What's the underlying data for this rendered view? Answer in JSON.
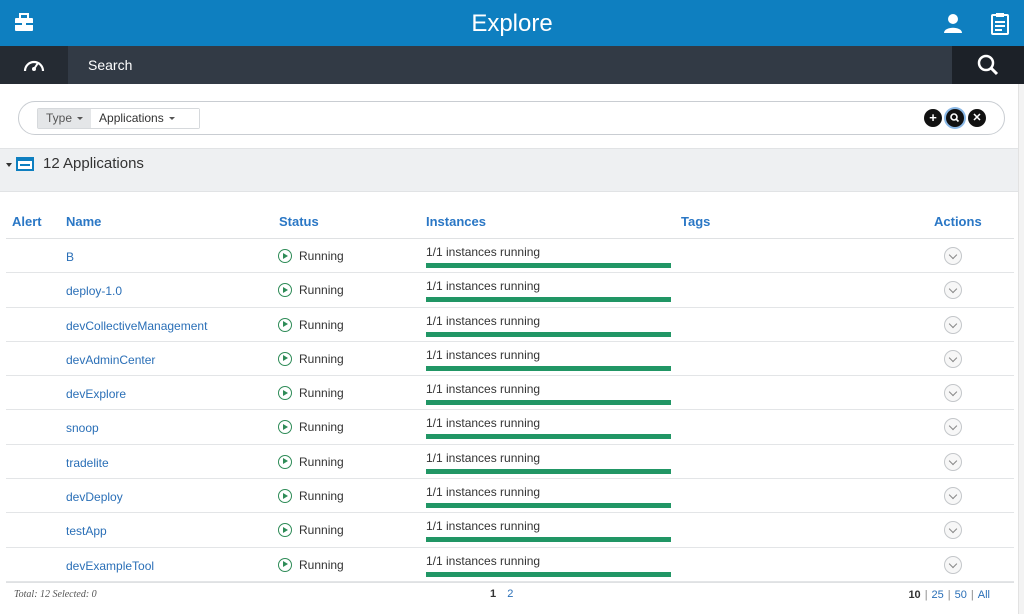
{
  "header": {
    "title": "Explore"
  },
  "nav": {
    "search_label": "Search"
  },
  "filter": {
    "type_label": "Type",
    "type_value": "Applications",
    "add_symbol": "+",
    "search_symbol": "⌕",
    "clear_symbol": "✕"
  },
  "section": {
    "count_label": "12 Applications"
  },
  "table": {
    "columns": {
      "alert": "Alert",
      "name": "Name",
      "status": "Status",
      "instances": "Instances",
      "tags": "Tags",
      "actions": "Actions"
    },
    "rows": [
      {
        "name": "B",
        "status": "Running",
        "instances": "1/1 instances running",
        "running_fraction": 1.0
      },
      {
        "name": "deploy-1.0",
        "status": "Running",
        "instances": "1/1 instances running",
        "running_fraction": 1.0
      },
      {
        "name": "devCollectiveManagement",
        "status": "Running",
        "instances": "1/1 instances running",
        "running_fraction": 1.0
      },
      {
        "name": "devAdminCenter",
        "status": "Running",
        "instances": "1/1 instances running",
        "running_fraction": 1.0
      },
      {
        "name": "devExplore",
        "status": "Running",
        "instances": "1/1 instances running",
        "running_fraction": 1.0
      },
      {
        "name": "snoop",
        "status": "Running",
        "instances": "1/1 instances running",
        "running_fraction": 1.0
      },
      {
        "name": "tradelite",
        "status": "Running",
        "instances": "1/1 instances running",
        "running_fraction": 1.0
      },
      {
        "name": "devDeploy",
        "status": "Running",
        "instances": "1/1 instances running",
        "running_fraction": 1.0
      },
      {
        "name": "testApp",
        "status": "Running",
        "instances": "1/1 instances running",
        "running_fraction": 1.0
      },
      {
        "name": "devExampleTool",
        "status": "Running",
        "instances": "1/1 instances running",
        "running_fraction": 1.0
      }
    ]
  },
  "footer": {
    "total_text": "Total: 12 Selected: 0",
    "pages": [
      "1",
      "2"
    ],
    "current_page": "1",
    "page_sizes": [
      "10",
      "25",
      "50",
      "All"
    ],
    "current_page_size": "10"
  },
  "colors": {
    "header_bg": "#0e7fc0",
    "nav_bg": "#323a45",
    "progress": "#219665",
    "link": "#2a6fb7"
  }
}
